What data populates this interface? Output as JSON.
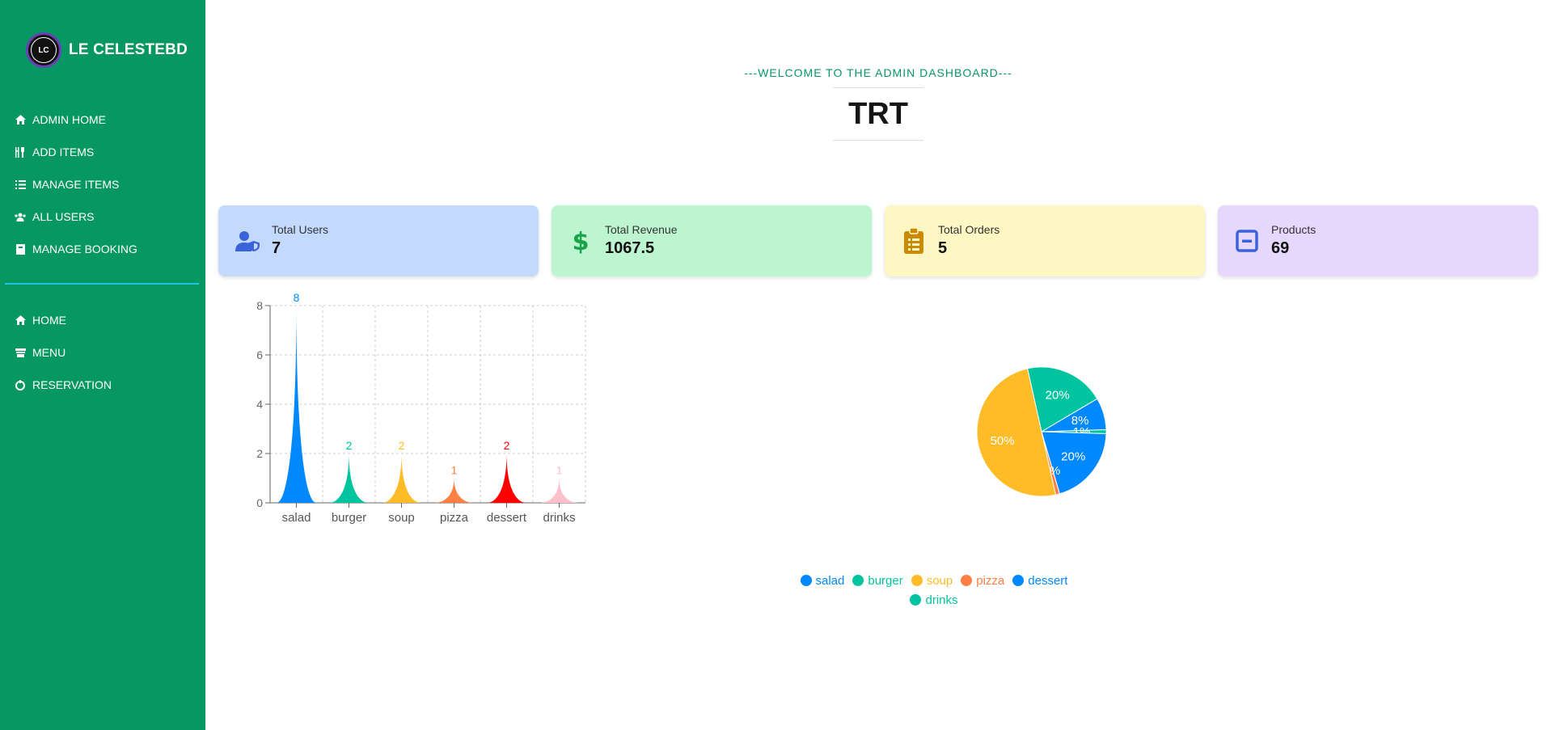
{
  "sidebar": {
    "brand": {
      "logo_text": "LC",
      "name": "LE CELESTEBD"
    },
    "admin_items": [
      {
        "label": "ADMIN HOME",
        "icon": "home-icon"
      },
      {
        "label": "ADD ITEMS",
        "icon": "utensils-icon"
      },
      {
        "label": "MANAGE ITEMS",
        "icon": "list-icon"
      },
      {
        "label": "ALL USERS",
        "icon": "users-icon"
      },
      {
        "label": "MANAGE BOOKING",
        "icon": "book-icon"
      }
    ],
    "site_items": [
      {
        "label": "HOME",
        "icon": "home-icon"
      },
      {
        "label": "MENU",
        "icon": "menu-icon"
      },
      {
        "label": "RESERVATION",
        "icon": "calendar-icon"
      }
    ]
  },
  "header": {
    "subtitle": "---WELCOME TO THE ADMIN DASHBOARD---",
    "title": "TRT"
  },
  "stats": [
    {
      "label": "Total Users",
      "value": "7",
      "icon": "user-shield-icon",
      "bg": "#c3dafe",
      "icon_color": "#3b63d9"
    },
    {
      "label": "Total Revenue",
      "value": "1067.5",
      "icon": "dollar-icon",
      "bg": "#bdf5d1",
      "icon_color": "#16a34a"
    },
    {
      "label": "Total Orders",
      "value": "5",
      "icon": "clipboard-icon",
      "bg": "#fef7c3",
      "icon_color": "#ca8a04"
    },
    {
      "label": "Products",
      "value": "69",
      "icon": "minus-square-icon",
      "bg": "#e6d8fd",
      "icon_color": "#3b63d9"
    }
  ],
  "chart_data": [
    {
      "type": "bar",
      "categories": [
        "salad",
        "burger",
        "soup",
        "pizza",
        "dessert",
        "drinks"
      ],
      "values": [
        8,
        2,
        2,
        1,
        2,
        1
      ],
      "colors": [
        "#0088fe",
        "#00c49f",
        "#ffbb28",
        "#ff8042",
        "#ff0000",
        "#ffc0cb"
      ],
      "yticks": [
        0,
        2,
        4,
        6,
        8
      ],
      "ylim": [
        0,
        8
      ],
      "grid": true,
      "title": "",
      "xlabel": "",
      "ylabel": ""
    },
    {
      "type": "pie",
      "labels": [
        "salad",
        "burger",
        "soup",
        "pizza",
        "dessert",
        "drinks"
      ],
      "values": [
        20,
        20,
        50,
        1,
        8,
        1
      ],
      "slice_labels": [
        "20%",
        "20%",
        "50%",
        "1%",
        "8%",
        "1%"
      ],
      "colors": [
        "#0088fe",
        "#00c49f",
        "#ffbb28",
        "#ff8042",
        "#0088fe",
        "#00c49f"
      ],
      "legend_position": "bottom"
    }
  ]
}
